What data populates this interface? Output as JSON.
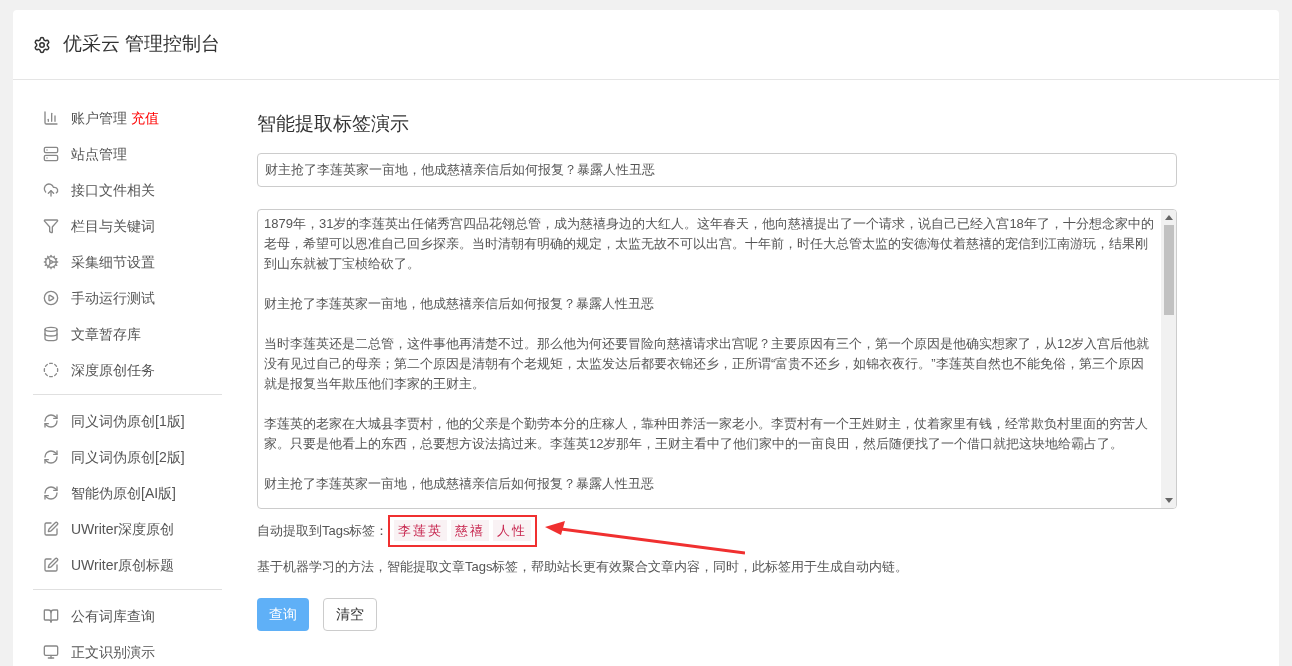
{
  "header": {
    "title": "优采云 管理控制台"
  },
  "sidebar": {
    "groups": [
      {
        "items": [
          {
            "label": "账户管理",
            "badge": "充值"
          },
          {
            "label": "站点管理"
          },
          {
            "label": "接口文件相关"
          },
          {
            "label": "栏目与关键词"
          },
          {
            "label": "采集细节设置"
          },
          {
            "label": "手动运行测试"
          },
          {
            "label": "文章暂存库"
          },
          {
            "label": "深度原创任务"
          }
        ]
      },
      {
        "items": [
          {
            "label": "同义词伪原创[1版]"
          },
          {
            "label": "同义词伪原创[2版]"
          },
          {
            "label": "智能伪原创[AI版]"
          },
          {
            "label": "UWriter深度原创"
          },
          {
            "label": "UWriter原创标题"
          }
        ]
      },
      {
        "items": [
          {
            "label": "公有词库查询"
          },
          {
            "label": "正文识别演示"
          }
        ]
      }
    ]
  },
  "main": {
    "heading": "智能提取标签演示",
    "title_input": {
      "value": "财主抢了李莲英家一亩地，他成慈禧亲信后如何报复？暴露人性丑恶"
    },
    "content_paragraphs": [
      "1879年，31岁的李莲英出任储秀宫四品花翎总管，成为慈禧身边的大红人。这年春天，他向慈禧提出了一个请求，说自己已经入宫18年了，十分想念家中的老母，希望可以恩准自己回乡探亲。当时清朝有明确的规定，太监无故不可以出宫。十年前，时任大总管太监的安德海仗着慈禧的宠信到江南游玩，结果刚到山东就被丁宝桢给砍了。",
      "财主抢了李莲英家一亩地，他成慈禧亲信后如何报复？暴露人性丑恶",
      "当时李莲英还是二总管，这件事他再清楚不过。那么他为何还要冒险向慈禧请求出宫呢？主要原因有三个，第一个原因是他确实想家了，从12岁入宫后他就没有见过自己的母亲；第二个原因是清朝有个老规矩，太监发达后都要衣锦还乡，正所谓“富贵不还乡，如锦衣夜行。”李莲英自然也不能免俗，第三个原因就是报复当年欺压他们李家的王财主。",
      "李莲英的老家在大城县李贾村，他的父亲是个勤劳本分的庄稼人，靠种田养活一家老小。李贾村有一个王姓财主，仗着家里有钱，经常欺负村里面的穷苦人家。只要是他看上的东西，总要想方设法搞过来。李莲英12岁那年，王财主看中了他们家中的一亩良田，然后随便找了一个借口就把这块地给霸占了。",
      "财主抢了李莲英家一亩地，他成慈禧亲信后如何报复？暴露人性丑恶"
    ],
    "tags_label": "自动提取到Tags标签：",
    "tags": [
      "李莲英",
      "慈禧",
      "人性"
    ],
    "description": "基于机器学习的方法，智能提取文章Tags标签，帮助站长更有效聚合文章内容，同时，此标签用于生成自动内链。",
    "buttons": [
      {
        "label": "查询",
        "kind": "primary"
      },
      {
        "label": "清空",
        "kind": "default"
      }
    ]
  }
}
